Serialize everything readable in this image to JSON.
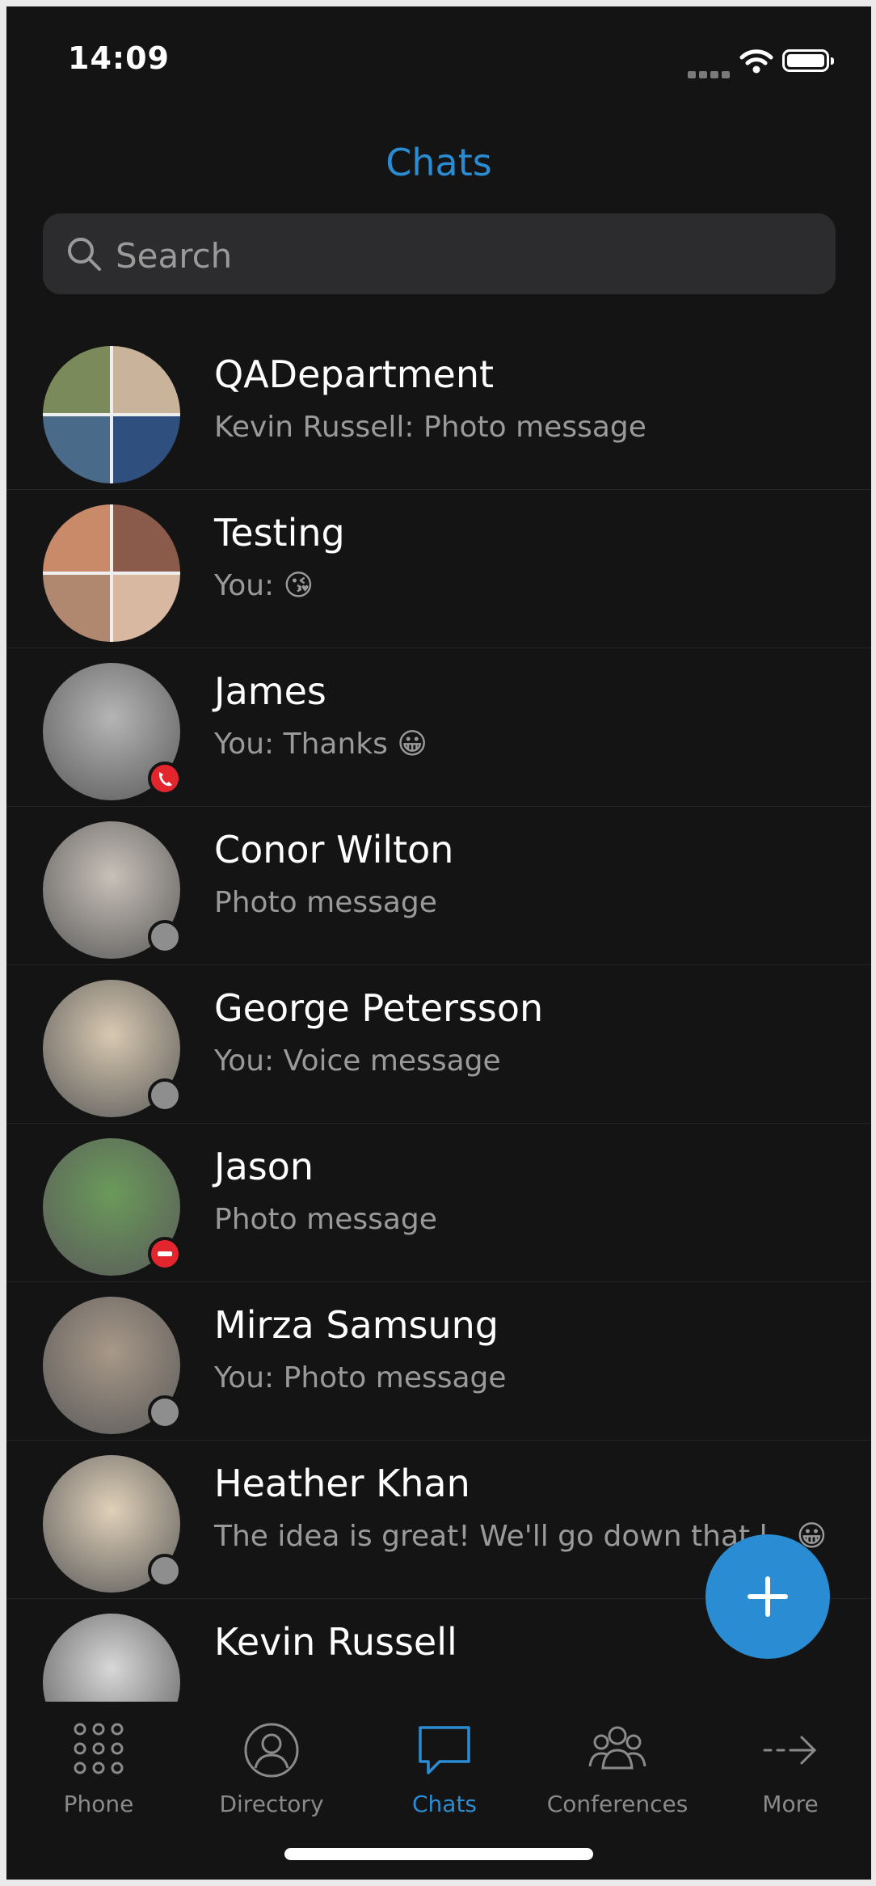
{
  "status": {
    "time": "14:09"
  },
  "header": {
    "title": "Chats"
  },
  "search": {
    "placeholder": "Search"
  },
  "chats": [
    {
      "name": "QADepartment",
      "message": "Kevin Russell: Photo message",
      "status": "none",
      "avatar_colors": [
        "#7a8a5a",
        "#c9b39a",
        "#4a6a8a",
        "#2f4f7f"
      ]
    },
    {
      "name": "Testing",
      "message": "You: 😘",
      "status": "none",
      "avatar_colors": [
        "#c98a6a",
        "#8a5a4a",
        "#b08870",
        "#d8b8a0"
      ]
    },
    {
      "name": "James",
      "message": "You: Thanks 😀",
      "status": "on-call",
      "avatar_colors": [
        "#b5b5b5"
      ]
    },
    {
      "name": "Conor Wilton",
      "message": "Photo message",
      "status": "offline",
      "avatar_colors": [
        "#c8c0b8"
      ]
    },
    {
      "name": "George Petersson",
      "message": "You: Voice message",
      "status": "offline",
      "avatar_colors": [
        "#d8c8b0"
      ]
    },
    {
      "name": "Jason",
      "message": "Photo message",
      "status": "busy",
      "avatar_colors": [
        "#6a9a5a"
      ]
    },
    {
      "name": "Mirza Samsung",
      "message": "You: Photo message",
      "status": "offline",
      "avatar_colors": [
        "#a89888"
      ]
    },
    {
      "name": "Heather Khan",
      "message": "The idea is great! We'll go down that l…😀",
      "status": "offline",
      "avatar_colors": [
        "#e0d0b8"
      ]
    },
    {
      "name": "Kevin Russell",
      "message": "",
      "status": "none",
      "avatar_colors": [
        "#d8d8d8"
      ]
    }
  ],
  "tabs": [
    {
      "label": "Phone",
      "icon": "dialpad-icon",
      "active": false
    },
    {
      "label": "Directory",
      "icon": "contact-icon",
      "active": false
    },
    {
      "label": "Chats",
      "icon": "chat-bubble-icon",
      "active": true
    },
    {
      "label": "Conferences",
      "icon": "group-icon",
      "active": false
    },
    {
      "label": "More",
      "icon": "arrow-right-icon",
      "active": false
    }
  ],
  "colors": {
    "accent": "#2a8dd4",
    "background": "#141414",
    "on_call": "#e3262e",
    "busy": "#e3262e",
    "offline": "#8e8e8e"
  }
}
